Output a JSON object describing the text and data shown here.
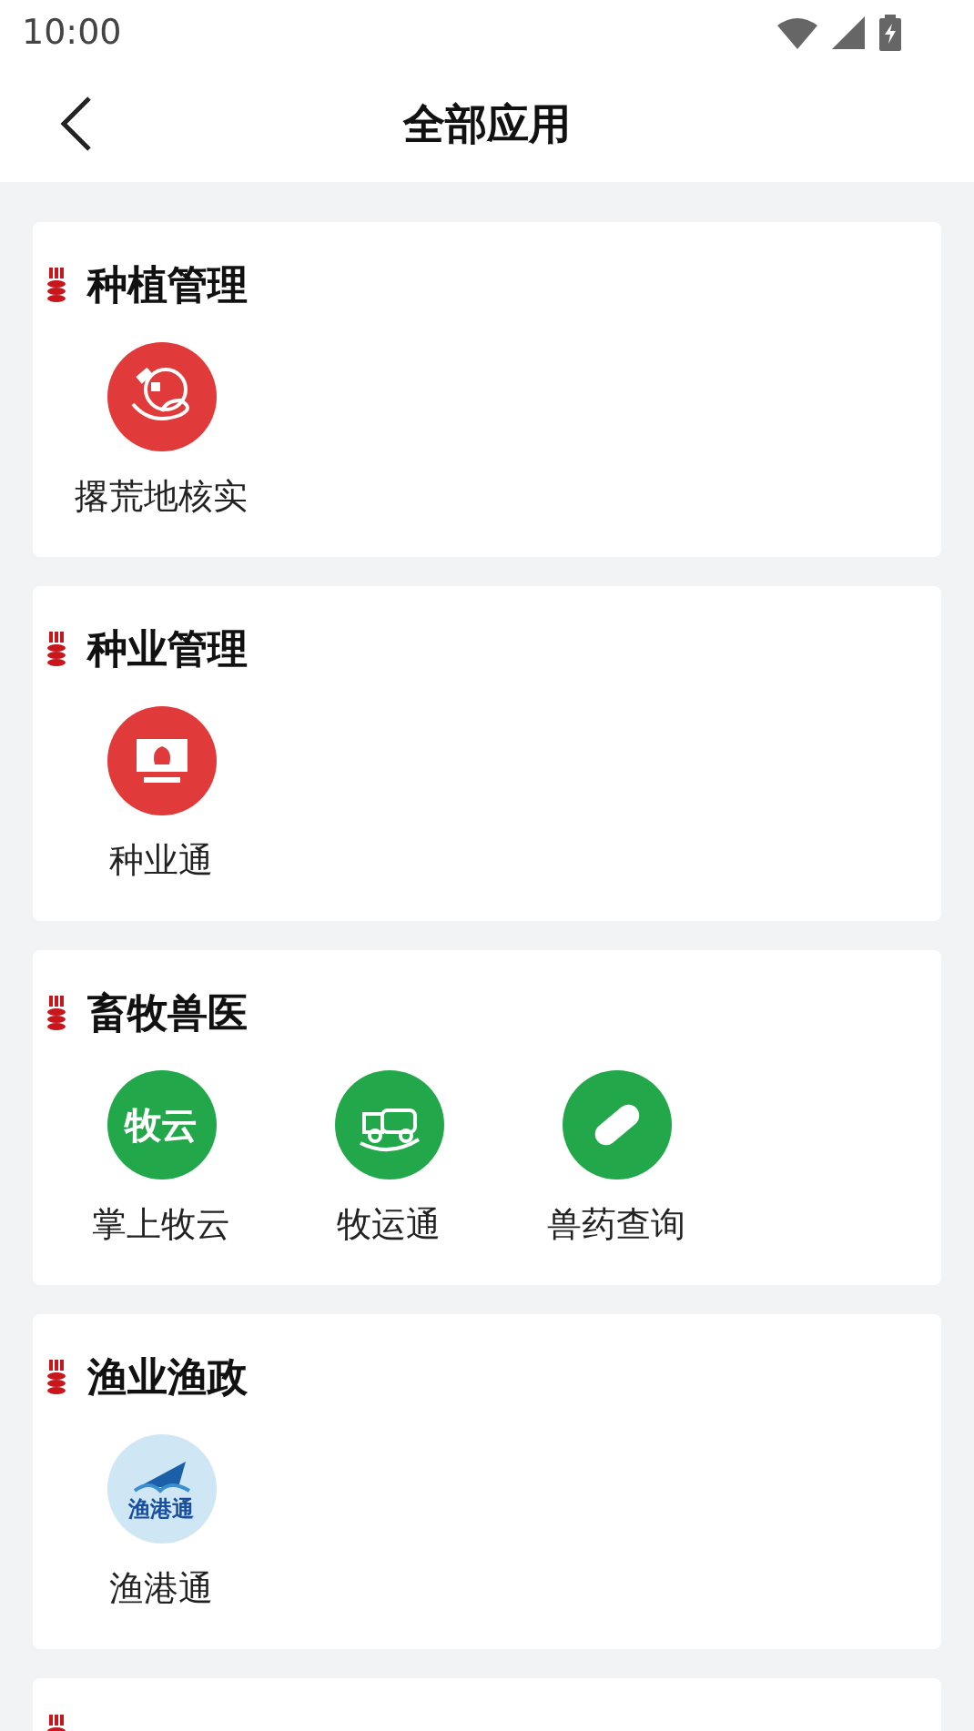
{
  "status_bar": {
    "time": "10:00"
  },
  "header": {
    "title": "全部应用"
  },
  "sections": [
    {
      "title": "种植管理",
      "apps": [
        {
          "label": "撂荒地核实",
          "kind": "satellite",
          "color": "#e03a3a"
        }
      ]
    },
    {
      "title": "种业管理",
      "apps": [
        {
          "label": "种业通",
          "kind": "monitor",
          "color": "#e03a3a"
        }
      ]
    },
    {
      "title": "畜牧兽医",
      "apps": [
        {
          "label": "掌上牧云",
          "kind": "logo",
          "logo_text": "牧云",
          "color": "#22a84a"
        },
        {
          "label": "牧运通",
          "kind": "truck",
          "color": "#22a84a"
        },
        {
          "label": "兽药查询",
          "kind": "pill",
          "color": "#22a84a"
        }
      ]
    },
    {
      "title": "渔业渔政",
      "apps": [
        {
          "label": "渔港通",
          "kind": "ship",
          "logo_text": "渔港通",
          "color": "#cfe6f5"
        }
      ]
    }
  ],
  "more_below": true
}
